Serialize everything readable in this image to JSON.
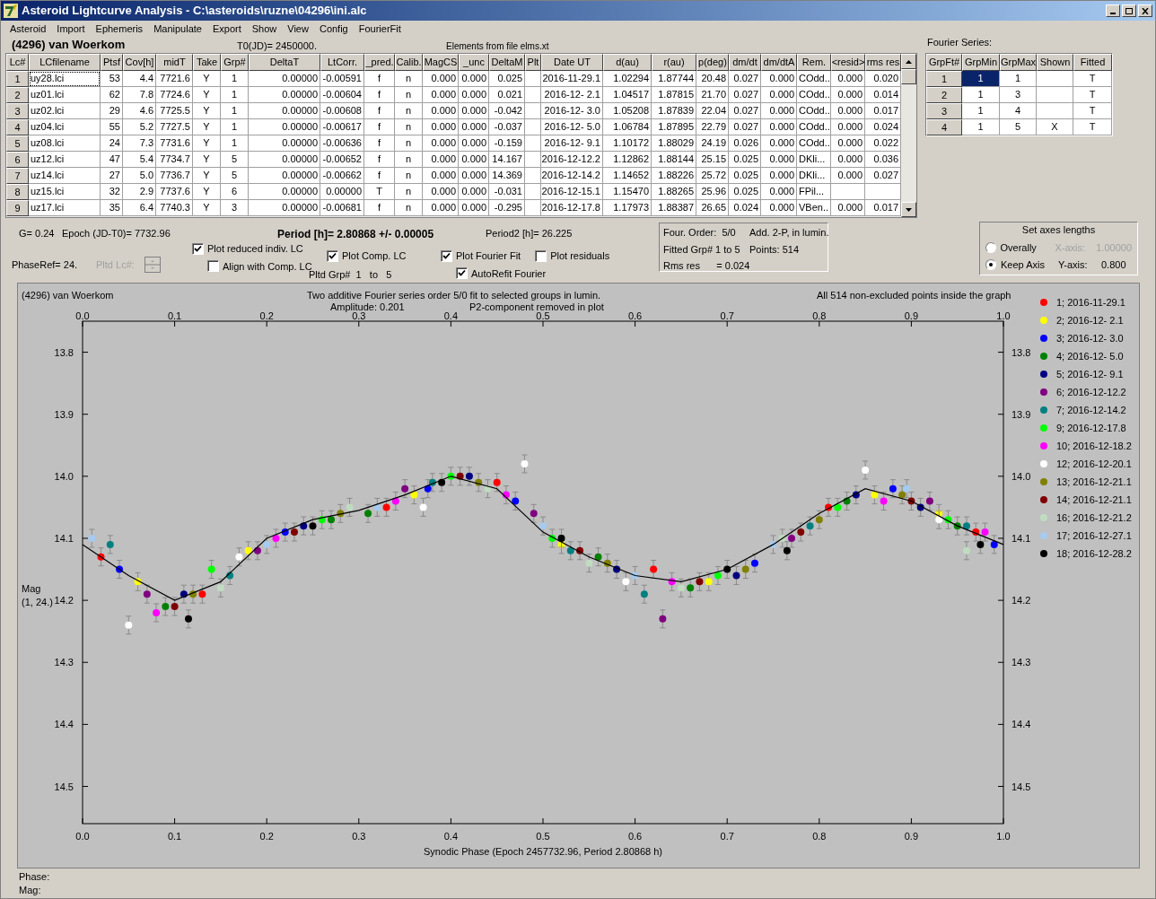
{
  "window": {
    "title": "Asteroid Lightcurve Analysis - C:\\asteroids\\ruzne\\04296\\ini.alc"
  },
  "menu": [
    "Asteroid",
    "Import",
    "Ephemeris",
    "Manipulate",
    "Export",
    "Show",
    "View",
    "Config",
    "FourierFit"
  ],
  "header": {
    "object": "(4296) van Woerkom",
    "t0": "T0(JD)= 2450000.",
    "elements": "Elements from file elms.xt",
    "fourier_label": "Fourier Series:"
  },
  "table": {
    "columns": [
      "Lc#",
      "LCfilename",
      "Ptsf",
      "Cov[h]",
      "midT",
      "Take",
      "Grp#",
      "DeltaT",
      "LtCorr.",
      "_pred.",
      "Calib.",
      "MagCS",
      "_unc",
      "DeltaM",
      "Plt",
      "Date UT",
      "d(au)",
      "r(au)",
      "p(deg)",
      "dm/dt",
      "dm/dtA",
      "Rem.",
      "<resid>",
      "rms res"
    ],
    "rows": [
      {
        "selected": true,
        "cells": [
          "1",
          "uy28.lci",
          "53",
          "4.4",
          "7721.6",
          "Y",
          "1",
          "0.00000",
          "-0.00591",
          "f",
          "n",
          "0.000",
          "0.000",
          "0.025",
          null,
          "2016-11-29.1",
          "1.02294",
          "1.87744",
          "20.48",
          "0.027",
          "0.000",
          "COdd..",
          "0.000",
          "0.020"
        ]
      },
      {
        "selected": false,
        "cells": [
          "2",
          "uz01.lci",
          "62",
          "7.8",
          "7724.6",
          "Y",
          "1",
          "0.00000",
          "-0.00604",
          "f",
          "n",
          "0.000",
          "0.000",
          "0.021",
          null,
          "2016-12- 2.1",
          "1.04517",
          "1.87815",
          "21.70",
          "0.027",
          "0.000",
          "COdd..",
          "0.000",
          "0.014"
        ]
      },
      {
        "selected": false,
        "cells": [
          "3",
          "uz02.lci",
          "29",
          "4.6",
          "7725.5",
          "Y",
          "1",
          "0.00000",
          "-0.00608",
          "f",
          "n",
          "0.000",
          "0.000",
          "-0.042",
          null,
          "2016-12- 3.0",
          "1.05208",
          "1.87839",
          "22.04",
          "0.027",
          "0.000",
          "COdd..",
          "0.000",
          "0.017"
        ]
      },
      {
        "selected": false,
        "cells": [
          "4",
          "uz04.lci",
          "55",
          "5.2",
          "7727.5",
          "Y",
          "1",
          "0.00000",
          "-0.00617",
          "f",
          "n",
          "0.000",
          "0.000",
          "-0.037",
          null,
          "2016-12- 5.0",
          "1.06784",
          "1.87895",
          "22.79",
          "0.027",
          "0.000",
          "COdd..",
          "0.000",
          "0.024"
        ]
      },
      {
        "selected": false,
        "cells": [
          "5",
          "uz08.lci",
          "24",
          "7.3",
          "7731.6",
          "Y",
          "1",
          "0.00000",
          "-0.00636",
          "f",
          "n",
          "0.000",
          "0.000",
          "-0.159",
          null,
          "2016-12- 9.1",
          "1.10172",
          "1.88029",
          "24.19",
          "0.026",
          "0.000",
          "COdd..",
          "0.000",
          "0.022"
        ]
      },
      {
        "selected": false,
        "cells": [
          "6",
          "uz12.lci",
          "47",
          "5.4",
          "7734.7",
          "Y",
          "5",
          "0.00000",
          "-0.00652",
          "f",
          "n",
          "0.000",
          "0.000",
          "14.167",
          null,
          "2016-12-12.2",
          "1.12862",
          "1.88144",
          "25.15",
          "0.025",
          "0.000",
          "DKli...",
          "0.000",
          "0.036"
        ]
      },
      {
        "selected": false,
        "cells": [
          "7",
          "uz14.lci",
          "27",
          "5.0",
          "7736.7",
          "Y",
          "5",
          "0.00000",
          "-0.00662",
          "f",
          "n",
          "0.000",
          "0.000",
          "14.369",
          null,
          "2016-12-14.2",
          "1.14652",
          "1.88226",
          "25.72",
          "0.025",
          "0.000",
          "DKli...",
          "0.000",
          "0.027"
        ]
      },
      {
        "selected": false,
        "cells": [
          "8",
          "uz15.lci",
          "32",
          "2.9",
          "7737.6",
          "Y",
          "6",
          "0.00000",
          "0.00000",
          "T",
          "n",
          "0.000",
          "0.000",
          "-0.031",
          null,
          "2016-12-15.1",
          "1.15470",
          "1.88265",
          "25.96",
          "0.025",
          "0.000",
          "FPil...",
          null,
          null
        ]
      },
      {
        "selected": false,
        "cells": [
          "9",
          "uz17.lci",
          "35",
          "6.4",
          "7740.3",
          "Y",
          "3",
          "0.00000",
          "-0.00681",
          "f",
          "n",
          "0.000",
          "0.000",
          "-0.295",
          null,
          "2016-12-17.8",
          "1.17973",
          "1.88387",
          "26.65",
          "0.024",
          "0.000",
          "VBen..",
          "0.000",
          "0.017"
        ]
      }
    ]
  },
  "fourier": {
    "columns": [
      "GrpFt#",
      "GrpMin",
      "GrpMax",
      "Shown",
      "Fitted"
    ],
    "rows": [
      {
        "selected": true,
        "cells": [
          "1",
          "1",
          "1",
          null,
          "T"
        ]
      },
      {
        "selected": false,
        "cells": [
          "2",
          "1",
          "3",
          null,
          "T"
        ]
      },
      {
        "selected": false,
        "cells": [
          "3",
          "1",
          "4",
          null,
          "T"
        ]
      },
      {
        "selected": false,
        "cells": [
          "4",
          "1",
          "5",
          "X",
          "T"
        ]
      }
    ]
  },
  "info": {
    "g": "G= 0.24",
    "epoch": "Epoch (JD-T0)= 7732.96",
    "period": "Period [h]= 2.80868 +/- 0.00005",
    "period2": "Period2 [h]= 26.225",
    "phase_ref": "PhaseRef= 24.",
    "pltd_lc": "Pltd Lc#:",
    "pltd_grp": "Pltd Grp#  1   to   5"
  },
  "checkboxes": [
    {
      "label": "Plot reduced indiv. LC",
      "checked": true
    },
    {
      "label": "Align with Comp. LC",
      "checked": false
    },
    {
      "label": "Plot Comp. LC",
      "checked": true
    },
    {
      "label": "Plot Fourier Fit",
      "checked": true
    },
    {
      "label": "Plot residuals",
      "checked": false
    },
    {
      "label": "AutoRefit Fourier",
      "checked": true
    }
  ],
  "fit_box": [
    "Four. Order:  5/0",
    "Add. 2-P, in lumin.",
    "Fitted Grp# 1 to 5",
    "Points: 514",
    "Rms res      = 0.024"
  ],
  "axes": {
    "title": "Set axes lengths",
    "options": [
      {
        "label": "Overally",
        "selected": false
      },
      {
        "label": "Keep Axis",
        "selected": true
      }
    ],
    "fields": [
      {
        "label": "X-axis:",
        "value": "1.00000",
        "disabled": true
      },
      {
        "label": "Y-axis:",
        "value": "0.800",
        "disabled": false
      }
    ]
  },
  "plot": {
    "object": "(4296) van Woerkom",
    "amplitude": "Amplitude: 0.201",
    "note": "P2-component removed in plot",
    "points_note": "All 514 non-excluded points inside the graph",
    "ylabel_sub": "(1, 24.)",
    "chart_data": {
      "type": "scatter",
      "title": "Two additive Fourier series order 5/0 fit to selected groups in lumin.",
      "xlabel": "Synodic Phase (Epoch 2457732.96, Period 2.80868 h)",
      "ylabel": "Mag",
      "xlim": [
        0,
        1
      ],
      "ylim": [
        14.56,
        13.75
      ],
      "xticks": [
        {
          "value": 0,
          "label": "0.0"
        },
        {
          "value": 0.1,
          "label": "0.1"
        },
        {
          "value": 0.2,
          "label": "0.2"
        },
        {
          "value": 0.3,
          "label": "0.3"
        },
        {
          "value": 0.4,
          "label": "0.4"
        },
        {
          "value": 0.5,
          "label": "0.5"
        },
        {
          "value": 0.6,
          "label": "0.6"
        },
        {
          "value": 0.7,
          "label": "0.7"
        },
        {
          "value": 0.8,
          "label": "0.8"
        },
        {
          "value": 0.9,
          "label": "0.9"
        },
        {
          "value": 1,
          "label": "1.0"
        }
      ],
      "yticks": [
        {
          "value": 13.8,
          "label": "13.8"
        },
        {
          "value": 13.9,
          "label": "13.9"
        },
        {
          "value": 14.0,
          "label": "14.0"
        },
        {
          "value": 14.1,
          "label": "14.1"
        },
        {
          "value": 14.2,
          "label": "14.2"
        },
        {
          "value": 14.3,
          "label": "14.3"
        },
        {
          "value": 14.4,
          "label": "14.4"
        },
        {
          "value": 14.5,
          "label": "14.5"
        }
      ],
      "series": [
        {
          "name": "1; 2016-11-29.1",
          "color": "#ff0000",
          "x": [
            0.02,
            0.13,
            0.33,
            0.45,
            0.62,
            0.81,
            0.97
          ],
          "values": [
            14.13,
            14.19,
            14.05,
            14.01,
            14.15,
            14.05,
            14.09
          ]
        },
        {
          "name": "2; 2016-12- 2.1",
          "color": "#ffff00",
          "x": [
            0.06,
            0.18,
            0.36,
            0.52,
            0.68,
            0.86,
            0.93
          ],
          "values": [
            14.17,
            14.12,
            14.03,
            14.11,
            14.17,
            14.03,
            14.06
          ]
        },
        {
          "name": "3; 2016-12- 3.0",
          "color": "#0000ff",
          "x": [
            0.04,
            0.22,
            0.375,
            0.47,
            0.73,
            0.88,
            0.99
          ],
          "values": [
            14.15,
            14.09,
            14.02,
            14.04,
            14.14,
            14.02,
            14.11
          ]
        },
        {
          "name": "4; 2016-12- 5.0",
          "color": "#008000",
          "x": [
            0.09,
            0.27,
            0.31,
            0.56,
            0.66,
            0.83,
            0.95
          ],
          "values": [
            14.21,
            14.07,
            14.06,
            14.13,
            14.18,
            14.04,
            14.08
          ]
        },
        {
          "name": "5; 2016-12- 9.1",
          "color": "#000080",
          "x": [
            0.11,
            0.24,
            0.42,
            0.58,
            0.71,
            0.84,
            0.91
          ],
          "values": [
            14.19,
            14.08,
            14.0,
            14.15,
            14.16,
            14.03,
            14.05
          ]
        },
        {
          "name": "6; 2016-12-12.2",
          "color": "#800080",
          "x": [
            0.07,
            0.19,
            0.35,
            0.49,
            0.63,
            0.77,
            0.92
          ],
          "values": [
            14.19,
            14.12,
            14.02,
            14.06,
            14.23,
            14.1,
            14.04
          ]
        },
        {
          "name": "7; 2016-12-14.2",
          "color": "#008080",
          "x": [
            0.03,
            0.16,
            0.38,
            0.53,
            0.61,
            0.79,
            0.96
          ],
          "values": [
            14.11,
            14.16,
            14.01,
            14.12,
            14.19,
            14.08,
            14.08
          ]
        },
        {
          "name": "9; 2016-12-17.8",
          "color": "#00ff00",
          "x": [
            0.14,
            0.26,
            0.4,
            0.51,
            0.69,
            0.82,
            0.94
          ],
          "values": [
            14.15,
            14.07,
            14.0,
            14.1,
            14.16,
            14.05,
            14.07
          ]
        },
        {
          "name": "10; 2016-12-18.2",
          "color": "#ff00ff",
          "x": [
            0.08,
            0.21,
            0.34,
            0.46,
            0.64,
            0.87,
            0.98
          ],
          "values": [
            14.22,
            14.1,
            14.04,
            14.03,
            14.17,
            14.04,
            14.09
          ]
        },
        {
          "name": "12; 2016-12-20.1",
          "color": "#ffffff",
          "x": [
            0.05,
            0.17,
            0.37,
            0.48,
            0.59,
            0.85,
            0.93
          ],
          "values": [
            14.24,
            14.13,
            14.05,
            13.98,
            14.17,
            13.99,
            14.07
          ]
        },
        {
          "name": "13; 2016-12-21.1",
          "color": "#808000",
          "x": [
            0.12,
            0.28,
            0.43,
            0.57,
            0.72,
            0.8,
            0.89
          ],
          "values": [
            14.19,
            14.06,
            14.01,
            14.14,
            14.15,
            14.07,
            14.03
          ]
        },
        {
          "name": "14; 2016-12-21.1",
          "color": "#800000",
          "x": [
            0.1,
            0.23,
            0.41,
            0.54,
            0.67,
            0.78,
            0.9
          ],
          "values": [
            14.21,
            14.09,
            14.0,
            14.12,
            14.17,
            14.09,
            14.04
          ]
        },
        {
          "name": "16; 2016-12-21.2",
          "color": "#c0dcc0",
          "x": [
            0.15,
            0.29,
            0.44,
            0.55,
            0.65,
            0.76,
            0.96
          ],
          "values": [
            14.18,
            14.05,
            14.02,
            14.14,
            14.18,
            14.1,
            14.12
          ]
        },
        {
          "name": "17; 2016-12-27.1",
          "color": "#a6caf0",
          "x": [
            0.01,
            0.2,
            0.32,
            0.5,
            0.6,
            0.75,
            0.895
          ],
          "values": [
            14.1,
            14.11,
            14.05,
            14.08,
            14.16,
            14.11,
            14.02
          ]
        },
        {
          "name": "18; 2016-12-28.2",
          "color": "#000000",
          "x": [
            0.115,
            0.25,
            0.39,
            0.52,
            0.7,
            0.765,
            0.975
          ],
          "values": [
            14.23,
            14.08,
            14.01,
            14.1,
            14.15,
            14.12,
            14.11
          ]
        },
        {
          "color": "#000000",
          "type": "line",
          "x": [
            0,
            0.05,
            0.1,
            0.15,
            0.2,
            0.25,
            0.3,
            0.35,
            0.4,
            0.45,
            0.5,
            0.55,
            0.6,
            0.65,
            0.7,
            0.75,
            0.8,
            0.85,
            0.9,
            0.95,
            1
          ],
          "values": [
            14.11,
            14.16,
            14.2,
            14.17,
            14.1,
            14.07,
            14.055,
            14.03,
            14.0,
            14.02,
            14.09,
            14.13,
            14.16,
            14.17,
            14.15,
            14.11,
            14.06,
            14.02,
            14.04,
            14.08,
            14.11
          ]
        }
      ]
    }
  },
  "status": [
    "Phase:",
    "Mag:"
  ]
}
